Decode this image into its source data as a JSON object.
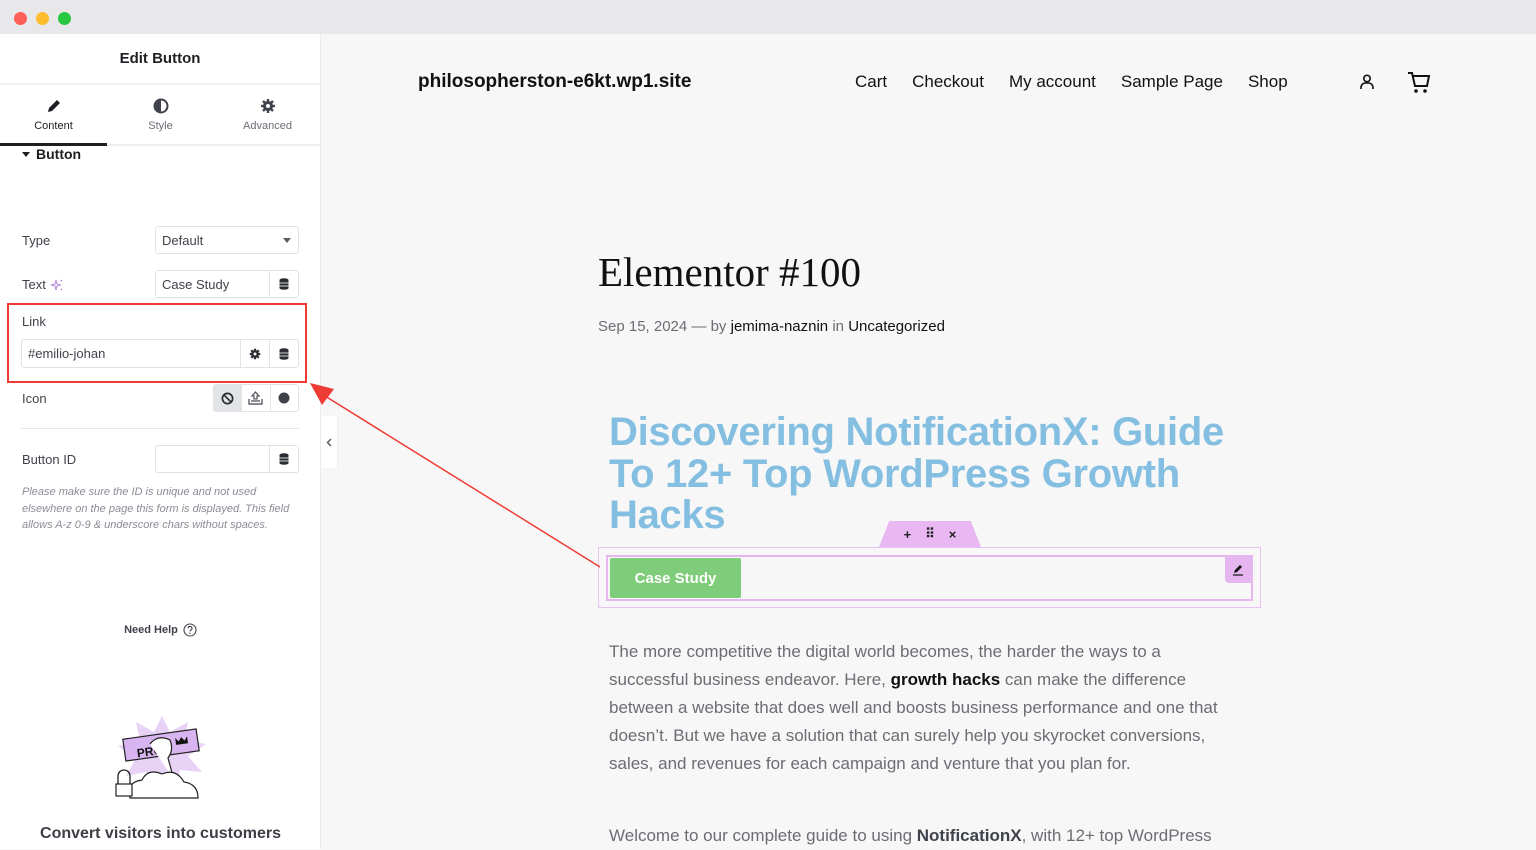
{
  "window": {
    "controls": [
      "close",
      "minimize",
      "maximize"
    ]
  },
  "panel": {
    "title": "Edit Button",
    "tabs": [
      {
        "label": "Content",
        "icon": "pencil-icon",
        "active": true
      },
      {
        "label": "Style",
        "icon": "half-circle-icon",
        "active": false
      },
      {
        "label": "Advanced",
        "icon": "gear-icon",
        "active": false
      }
    ],
    "section_title": "Button",
    "fields": {
      "type": {
        "label": "Type",
        "value": "Default"
      },
      "text": {
        "label": "Text",
        "value": "Case Study"
      },
      "link": {
        "label": "Link",
        "value": "#emilio-johan"
      },
      "icon": {
        "label": "Icon",
        "options": [
          "none-icon",
          "upload-icon",
          "circle-icon"
        ],
        "selected": "none-icon"
      },
      "button_id": {
        "label": "Button ID",
        "value": ""
      }
    },
    "help_text": "Please make sure the ID is unique and not used elsewhere on the page this form is displayed. This field allows A-z  0-9 & underscore chars without spaces.",
    "need_help": "Need Help",
    "promo": {
      "badge": "PRO",
      "text": "Convert visitors into customers"
    }
  },
  "site": {
    "title": "philosopherston-e6kt.wp1.site",
    "nav": [
      "Cart",
      "Checkout",
      "My account",
      "Sample Page",
      "Shop"
    ]
  },
  "post": {
    "title": "Elementor #100",
    "date": "Sep 15, 2024",
    "by": "— by",
    "author": "jemima-naznin",
    "in": "in",
    "category": "Uncategorized",
    "heading": "Discovering NotificationX: Guide To 12+ Top WordPress Growth Hacks",
    "button_label": "Case Study",
    "toolbar": [
      "+",
      "⠿",
      "×"
    ],
    "paragraph1": {
      "before": "The more competitive the digital world becomes, the harder the ways to a successful business endeavor. Here, ",
      "bold": "growth hacks",
      "after": " can make the difference between a website that does well and boosts business performance and one that doesn’t. But we have a solution that can surely help you skyrocket conversions, sales, and revenues for each campaign and venture that you plan for."
    },
    "paragraph2": {
      "before": "Welcome to our complete guide to using ",
      "bold": "NotificationX",
      "after": ", with 12+ top WordPress"
    }
  },
  "annotation": {
    "color": "#ee3b33"
  },
  "colors": {
    "accent_green": "#7fcd7a",
    "heading_blue": "#84bfe1",
    "selection_purple": "#e6b6f1"
  }
}
